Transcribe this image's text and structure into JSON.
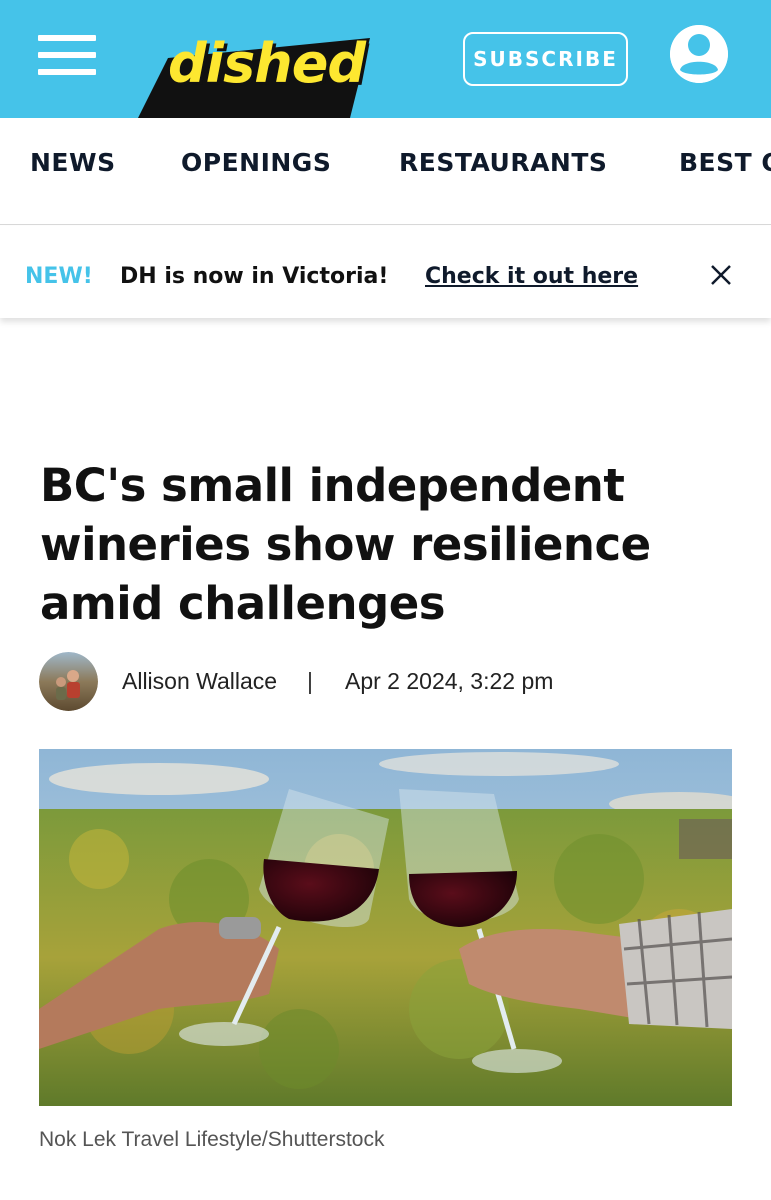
{
  "header": {
    "logo_text": "dished",
    "subscribe_label": "SUBSCRIBE",
    "menu_icon": "hamburger-menu-icon",
    "account_icon": "user-account-icon",
    "brand_color": "#45c3e9",
    "logo_color": "#fde730"
  },
  "nav": {
    "items": [
      {
        "label": "NEWS"
      },
      {
        "label": "OPENINGS"
      },
      {
        "label": "RESTAURANTS"
      },
      {
        "label": "BEST O"
      }
    ]
  },
  "banner": {
    "badge": "NEW!",
    "message": "DH is now in Victoria!",
    "link_text": "Check it out here",
    "close_icon": "close-icon"
  },
  "article": {
    "title": "BC's small independent wineries show resilience amid challenges",
    "author": "Allison Wallace",
    "separator": "|",
    "date": "Apr 2 2024, 3:22 pm",
    "image_credit": "Nok Lek Travel Lifestyle/Shutterstock"
  }
}
